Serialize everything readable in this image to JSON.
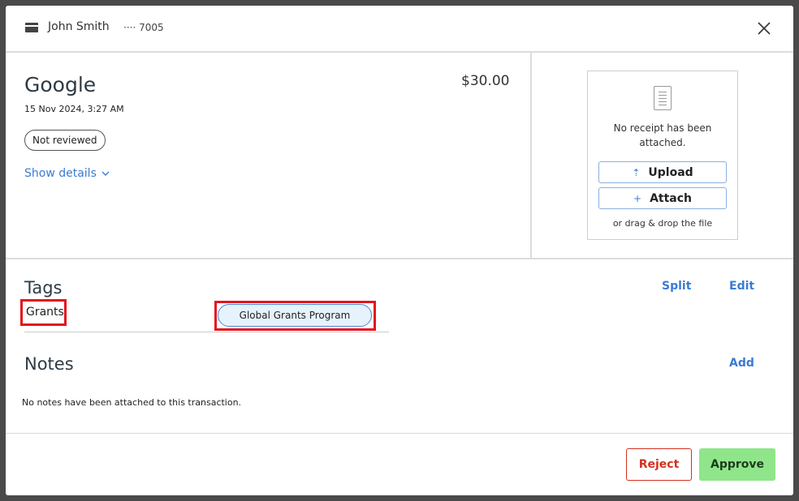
{
  "header": {
    "card_icon": "credit-card-icon",
    "cardholder": "John Smith",
    "card_number": "···· 7005",
    "close_icon": "close-icon"
  },
  "transaction": {
    "merchant": "Google",
    "amount": "$30.00",
    "datetime": "15 Nov 2024, 3:27 AM",
    "status": "Not reviewed",
    "show_details_label": "Show details"
  },
  "receipt": {
    "icon": "document-icon",
    "message": "No receipt has been attached.",
    "upload_label": "Upload",
    "attach_label": "Attach",
    "drag_hint": "or drag & drop the file"
  },
  "tags": {
    "title": "Tags",
    "split_label": "Split",
    "edit_label": "Edit",
    "category": "Grants",
    "value": "Global Grants Program"
  },
  "notes": {
    "title": "Notes",
    "add_label": "Add",
    "empty_message": "No notes have been attached to this transaction."
  },
  "actions": {
    "reject_label": "Reject",
    "approve_label": "Approve"
  },
  "colors": {
    "link": "#3a7bd5",
    "highlight": "#e3141e",
    "approve_bg": "#8fe68a",
    "reject": "#d4301f"
  }
}
